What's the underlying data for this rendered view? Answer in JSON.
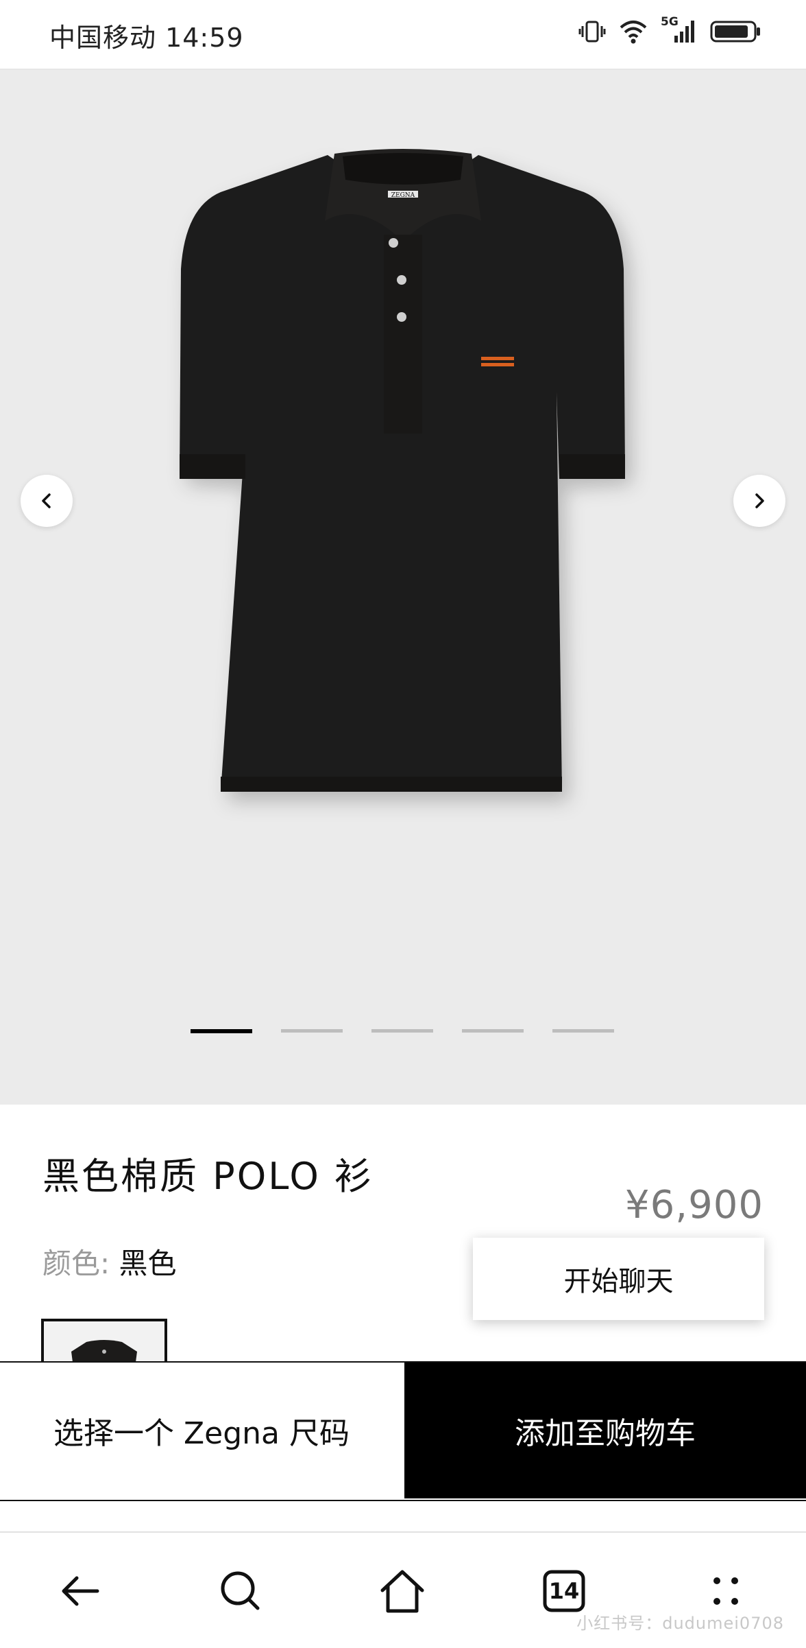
{
  "status_bar": {
    "carrier_time": "中国移动 14:59",
    "network": "5G",
    "icons": [
      "vibrate-icon",
      "wifi-icon",
      "signal-icon",
      "battery-icon"
    ]
  },
  "gallery": {
    "image_brand": "ZEGNA",
    "total_images": 5,
    "active_index": 0,
    "prev_icon": "chevron-left-icon",
    "next_icon": "chevron-right-icon"
  },
  "product": {
    "title": "黑色棉质 POLO 衫",
    "price": "¥6,900",
    "color_label": "颜色:",
    "color_value": "黑色"
  },
  "chat": {
    "label": "开始聊天"
  },
  "actions": {
    "size_label": "选择一个 Zegna 尺码",
    "cart_label": "添加至购物车"
  },
  "bottom_nav": {
    "tab_count": "14",
    "icons": [
      "back-arrow-icon",
      "search-icon",
      "home-icon",
      "tabs-icon",
      "menu-dots-icon"
    ]
  },
  "watermark": "小红书号：dudumei0708",
  "colors": {
    "accent": "#000000",
    "price": "#7a7a7a",
    "gallery_bg": "#ebebeb",
    "stripe": "#d9601f"
  }
}
